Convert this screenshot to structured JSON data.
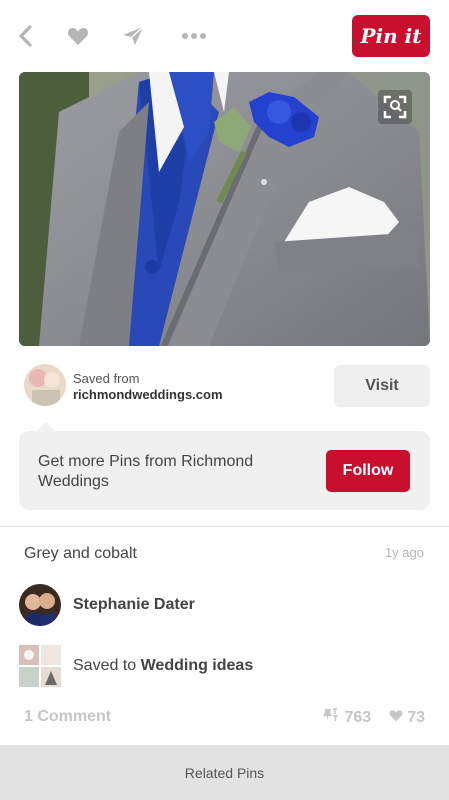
{
  "topbar": {
    "icons": [
      "back-icon",
      "heart-icon",
      "send-icon",
      "more-icon"
    ],
    "pin_it_label": "Pin it"
  },
  "pin": {
    "image_alt": "groom-suit-photo",
    "expand_icon": "expand-icon"
  },
  "source": {
    "saved_from_label": "Saved from",
    "domain": "richmondweddings.com",
    "visit_label": "Visit"
  },
  "follow_card": {
    "text": "Get more Pins from Richmond Weddings",
    "follow_label": "Follow"
  },
  "details": {
    "description": "Grey and cobalt",
    "age": "1y ago",
    "pinner_name": "Stephanie Dater",
    "saved_to_prefix": "Saved to ",
    "board_name": "Wedding ideas",
    "comments": "1 Comment",
    "repins": "763",
    "likes": "73"
  },
  "footer": {
    "related_label": "Related Pins"
  },
  "colors": {
    "accent": "#c8102e",
    "icon_gray": "#b5b5b5"
  }
}
